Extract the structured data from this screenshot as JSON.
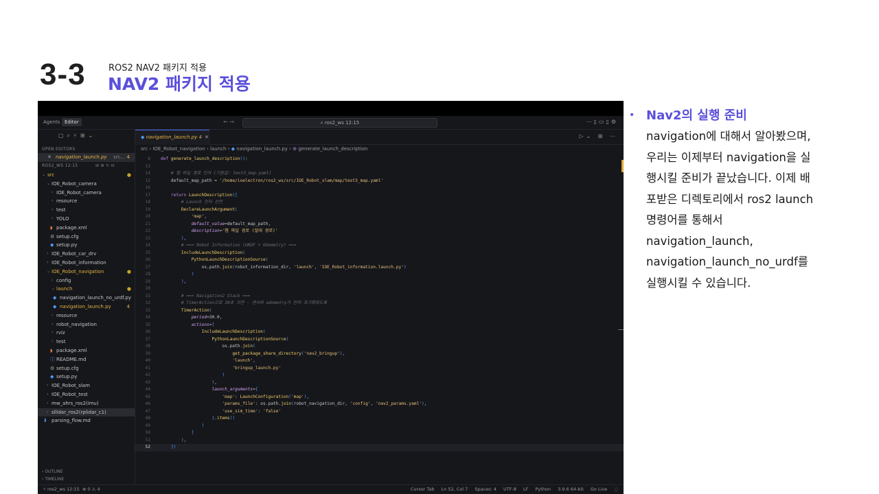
{
  "slide": {
    "number": "3-3",
    "subtitle_small": "ROS2 NAV2 패키지 적용",
    "subtitle_big": "NAV2 패키지 적용",
    "bullet_title": "Nav2의 실행 준비",
    "bullet_lines": [
      "navigation에 대해서 알아봤으며,",
      "우리는 이제부터 navigation을 실",
      "행시킬 준비가 끝났습니다. 이제 배",
      "포받은 디렉토리에서 ros2 launch",
      "명령어를 통해서",
      "navigation_launch,",
      "navigation_launch_no_urdf를",
      "실행시킬 수 있습니다."
    ]
  },
  "editor": {
    "titlebar": {
      "agents": "Agents",
      "editor": "Editor",
      "search": "ros2_ws 12:15"
    },
    "sidebar": {
      "open_editors": "OPEN EDITORS",
      "open_file": "navigation_launch.py",
      "open_file_dir": "src...",
      "open_file_count": "4",
      "workspace": "ROS2_WS 12:15",
      "items": [
        "src",
        "IOE_Robot_camera",
        "IOE_Robot_camera",
        "resource",
        "test",
        "YOLO",
        "package.xml",
        "setup.cfg",
        "setup.py",
        "IOE_Robot_car_drv",
        "IOE_Robot_information",
        "IOE_Robot_navigation",
        "config",
        "launch",
        "navigation_launch_no_urdf.py",
        "navigation_launch.py",
        "resource",
        "robot_navigation",
        "rviz",
        "test",
        "package.xml",
        "README.md",
        "setup.cfg",
        "setup.py",
        "IOE_Robot_slam",
        "IOE_Robot_test",
        "mw_ahrs_ros2(imu)",
        "sllidar_ros2(rplidar_c1)",
        "parsing_flow.md"
      ],
      "nav_count": "4",
      "outline": "OUTLINE",
      "timeline": "TIMELINE"
    },
    "tab": {
      "label": "navigation_launch.py",
      "count": "4"
    },
    "breadcrumb": {
      "parts": [
        "src",
        "IOE_Robot_navigation",
        "launch",
        "navigation_launch.py",
        "generate_launch_description"
      ]
    },
    "code_lines": [
      {
        "n": "8",
        "t": "def generate_launch_description():"
      },
      {
        "n": "13",
        "t": ""
      },
      {
        "n": "14",
        "t": "    # 맵 파일 경로 인자 (기본값: test3_map.yaml)"
      },
      {
        "n": "15",
        "t": "    default_map_path = '/home/ioelectron/ros2_ws/src/IOE_Robot_slam/map/test3_map.yaml'"
      },
      {
        "n": "16",
        "t": ""
      },
      {
        "n": "17",
        "t": "    return LaunchDescription(["
      },
      {
        "n": "18",
        "t": "        # Launch 인자 선언"
      },
      {
        "n": "19",
        "t": "        DeclareLaunchArgument("
      },
      {
        "n": "20",
        "t": "            'map',"
      },
      {
        "n": "21",
        "t": "            default_value=default_map_path,"
      },
      {
        "n": "22",
        "t": "            description='맵 파일 경로 (절대 경로)'"
      },
      {
        "n": "23",
        "t": "        ),"
      },
      {
        "n": "24",
        "t": "        # === Robot Information (URDF + Odometry) ==="
      },
      {
        "n": "25",
        "t": "        IncludeLaunchDescription("
      },
      {
        "n": "26",
        "t": "            PythonLaunchDescriptionSource("
      },
      {
        "n": "27",
        "t": "                os.path.join(robot_information_dir, 'launch', 'IOE_Robot_information.launch.py')"
      },
      {
        "n": "28",
        "t": "            )"
      },
      {
        "n": "29",
        "t": "        ),"
      },
      {
        "n": "30",
        "t": ""
      },
      {
        "n": "31",
        "t": "        # === Navigation2 Stack ==="
      },
      {
        "n": "32",
        "t": "        # TimerAction으로 30초 지연 - 센서와 odometry가 먼저 초기화되도록"
      },
      {
        "n": "33",
        "t": "        TimerAction("
      },
      {
        "n": "34",
        "t": "            period=30.0,"
      },
      {
        "n": "35",
        "t": "            actions=["
      },
      {
        "n": "36",
        "t": "                IncludeLaunchDescription("
      },
      {
        "n": "37",
        "t": "                    PythonLaunchDescriptionSource("
      },
      {
        "n": "38",
        "t": "                        os.path.join("
      },
      {
        "n": "39",
        "t": "                            get_package_share_directory('nav2_bringup'),"
      },
      {
        "n": "40",
        "t": "                            'launch',"
      },
      {
        "n": "41",
        "t": "                            'bringup_launch.py'"
      },
      {
        "n": "42",
        "t": "                        )"
      },
      {
        "n": "43",
        "t": "                    ),"
      },
      {
        "n": "44",
        "t": "                    launch_arguments={"
      },
      {
        "n": "45",
        "t": "                        'map': LaunchConfiguration('map'),"
      },
      {
        "n": "46",
        "t": "                        'params_file': os.path.join(robot_navigation_dir, 'config', 'nav2_params.yaml'),"
      },
      {
        "n": "47",
        "t": "                        'use_sim_time': 'false'"
      },
      {
        "n": "48",
        "t": "                    }.items()"
      },
      {
        "n": "49",
        "t": "                )"
      },
      {
        "n": "50",
        "t": "            ]"
      },
      {
        "n": "51",
        "t": "        ),"
      },
      {
        "n": "52",
        "t": "    ])"
      }
    ],
    "status": {
      "branch": "ros2_ws 12:15",
      "problems": "⊗ 0 ⚠ 4",
      "right": [
        "Cursor Tab",
        "Ln 52, Col 7",
        "Spaces: 4",
        "UTF-8",
        "LF",
        "Python",
        "3.9.6 64-bit",
        "Go Live"
      ]
    }
  }
}
